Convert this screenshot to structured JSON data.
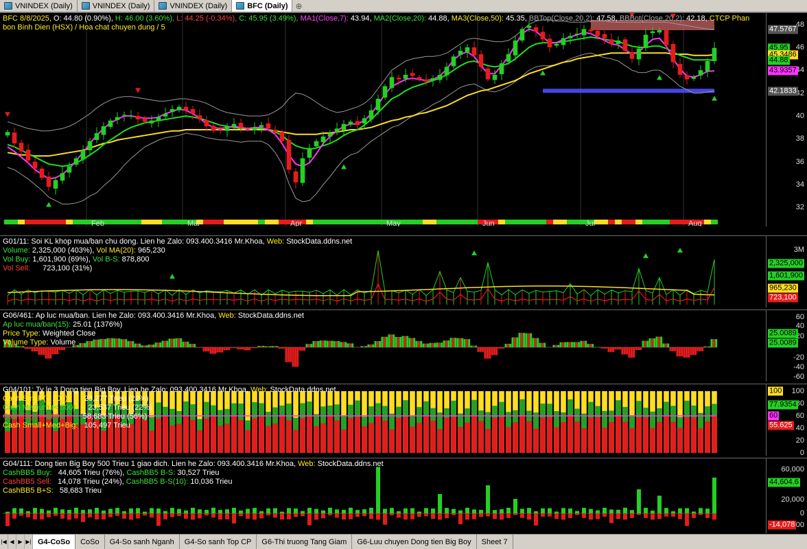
{
  "tabs": [
    {
      "label": "VNINDEX (Daily)",
      "active": false
    },
    {
      "label": "VNINDEX (Daily)",
      "active": false
    },
    {
      "label": "VNINDEX (Daily)",
      "active": false
    },
    {
      "label": "BFC (Daily)",
      "active": true
    }
  ],
  "colors": {
    "up": "#23d123",
    "down": "#e61c1c",
    "ma7": "#ff33ff",
    "ma20": "#22dd22",
    "ma50": "#ffdd22",
    "bb": "#9a9a9a",
    "resistance": "#c86464",
    "support": "#4d4dff"
  },
  "price_panel": {
    "legend_line1_parts": [
      {
        "t": "BFC 8/8/2025, ",
        "c": "c-yellow"
      },
      {
        "t": "O: 44.80 (0.90%), ",
        "c": "c-white"
      },
      {
        "t": "H: 46.00 (3.60%), ",
        "c": "c-green"
      },
      {
        "t": "L: 44.25 (-0.34%), ",
        "c": "c-red"
      },
      {
        "t": "C: 45.95 (3.49%), ",
        "c": "c-green"
      },
      {
        "t": "MA1(Close,7): ",
        "c": "c-magenta"
      },
      {
        "t": "43.94, ",
        "c": "c-white"
      },
      {
        "t": "MA2(Close,20): ",
        "c": "c-green"
      },
      {
        "t": "44.88, ",
        "c": "c-white"
      },
      {
        "t": "MA3(Close,50): ",
        "c": "c-yellow"
      },
      {
        "t": "45.35, ",
        "c": "c-white"
      },
      {
        "t": "BBTop(Close,20,2): ",
        "c": "c-gray"
      },
      {
        "t": "47.58, ",
        "c": "c-white"
      },
      {
        "t": "BBBot(Close,20,2): ",
        "c": "c-gray"
      },
      {
        "t": "42.18, ",
        "c": "c-white"
      },
      {
        "t": "CTCP Phan",
        "c": "c-yellow"
      }
    ],
    "legend_line2": "bon Binh Dien (HSX) / Hoa chat chuyen dung / 5",
    "y_ticks": [
      "48",
      "46",
      "44",
      "42",
      "40",
      "38",
      "36",
      "34",
      "32"
    ],
    "badges": [
      {
        "label": "47.5767",
        "bg": "#555",
        "fg": "#fff",
        "value": 47.5767
      },
      {
        "label": "45.95",
        "bg": "#23d123",
        "fg": "#000",
        "value": 45.95
      },
      {
        "label": "45.3486",
        "bg": "#ffdd22",
        "fg": "#000",
        "value": 45.3486
      },
      {
        "label": "44.88",
        "bg": "#23d123",
        "fg": "#000",
        "value": 44.88
      },
      {
        "label": "43.9357",
        "bg": "#ff33ff",
        "fg": "#000",
        "value": 43.9357
      },
      {
        "label": "42.1833",
        "bg": "#555",
        "fg": "#fff",
        "value": 42.1833
      }
    ],
    "x_labels": [
      {
        "label": "Feb",
        "i": 12
      },
      {
        "label": "Mar",
        "i": 26
      },
      {
        "label": "Apr",
        "i": 41
      },
      {
        "label": "May",
        "i": 55
      },
      {
        "label": "Jun",
        "i": 69
      },
      {
        "label": "Jul",
        "i": 84
      },
      {
        "label": "Aug",
        "i": 99
      }
    ]
  },
  "volume_panel": {
    "legend": [
      [
        {
          "t": "G01/11: Soi KL khop mua/ban chu dong. Lien he Zalo: ",
          "c": "c-white"
        },
        {
          "t": "093.400.3416 Mr.Khoa, ",
          "c": "c-white"
        },
        {
          "t": "Web: ",
          "c": "c-yellow"
        },
        {
          "t": "StockData.ddns.net",
          "c": "c-white"
        }
      ],
      [
        {
          "t": "Volume: ",
          "c": "c-green"
        },
        {
          "t": "2,325,000 (403%), ",
          "c": "c-white"
        },
        {
          "t": "Vol MA(20): ",
          "c": "c-yellow"
        },
        {
          "t": "965,230",
          "c": "c-white"
        }
      ],
      [
        {
          "t": "Vol Buy: ",
          "c": "c-green"
        },
        {
          "t": "1,601,900 (69%), ",
          "c": "c-white"
        },
        {
          "t": "Vol B-S: ",
          "c": "c-green"
        },
        {
          "t": "878,800",
          "c": "c-white"
        }
      ],
      [
        {
          "t": "Vol Sell: ",
          "c": "c-red"
        },
        {
          "t": "     723,100 (31%)",
          "c": "c-white"
        }
      ]
    ],
    "y_ticks": [
      "3M"
    ],
    "badges": [
      {
        "label": "2,325,000",
        "bg": "#23d123",
        "fg": "#000"
      },
      {
        "label": "1,601,900",
        "bg": "#23d123",
        "fg": "#000"
      },
      {
        "label": "965,230",
        "bg": "#ffdd22",
        "fg": "#000"
      },
      {
        "label": "723,100",
        "bg": "#e61c1c",
        "fg": "#fff"
      }
    ]
  },
  "pressure_panel": {
    "legend": [
      [
        {
          "t": "G06/461: Ap luc mua/ban. Lien he Zalo: 093.400.3416 Mr.Khoa, ",
          "c": "c-white"
        },
        {
          "t": "Web: ",
          "c": "c-yellow"
        },
        {
          "t": "StockData.ddns.net",
          "c": "c-white"
        }
      ],
      [
        {
          "t": "Ap luc mua/ban(15): ",
          "c": "c-green"
        },
        {
          "t": "25.01 (1376%)",
          "c": "c-white"
        }
      ],
      [
        {
          "t": "Price Type: ",
          "c": "c-yellow"
        },
        {
          "t": "Weighted Close",
          "c": "c-white"
        }
      ],
      [
        {
          "t": "Volume Type: ",
          "c": "c-yellow"
        },
        {
          "t": "Volume",
          "c": "c-white"
        }
      ]
    ],
    "y_ticks": [
      "60",
      "40",
      "20",
      "-20",
      "-40",
      "-60"
    ],
    "badges": [
      {
        "label": "25.0089",
        "bg": "#23d123",
        "fg": "#000"
      },
      {
        "label": "25.0089",
        "bg": "#23d123",
        "fg": "#000"
      }
    ]
  },
  "ratio_panel": {
    "legend": [
      [
        {
          "t": "G04/101: Ty le 3 Dong tien Big Boy. Lien he Zalo: 093.400.3416 Mr.Khoa, ",
          "c": "c-white"
        },
        {
          "t": "Web: ",
          "c": "c-yellow"
        },
        {
          "t": "StockData.ddns.net",
          "c": "c-white"
        }
      ],
      [
        {
          "t": "Cash Small (< 200):",
          "c": "c-yellow"
        },
        {
          "t": "       23,277 Trieu (22%)",
          "c": "c-white"
        }
      ],
      [
        {
          "t": "Cash Medium (< 500):",
          "c": "c-green"
        },
        {
          "t": "     23,537 Trieu (22%)",
          "c": "c-white"
        }
      ],
      [
        {
          "t": "Cash Big (>=500):",
          "c": "c-red"
        },
        {
          "t": "         58,683 Trieu (56%)",
          "c": "c-white"
        }
      ],
      [
        {
          "t": "Cash Small+Med+Big:",
          "c": "c-yellow"
        },
        {
          "t": "   105,497 Trieu",
          "c": "c-white"
        }
      ]
    ],
    "y_ticks": [
      "100",
      "80",
      "60",
      "40",
      "20",
      "0"
    ],
    "badges": [
      {
        "label": "100",
        "bg": "#ffdd22",
        "fg": "#000"
      },
      {
        "label": "77.9354",
        "bg": "#23d123",
        "fg": "#000"
      },
      {
        "label": "60",
        "bg": "#ff33ff",
        "fg": "#000"
      },
      {
        "label": "55.625",
        "bg": "#e61c1c",
        "fg": "#fff"
      }
    ]
  },
  "bigboy_panel": {
    "legend": [
      [
        {
          "t": "G04/111: Dong tien Big Boy 500 Trieu 1 giao dich. Lien he Zalo: 093.400.3416 Mr.Khoa, ",
          "c": "c-white"
        },
        {
          "t": "Web: ",
          "c": "c-yellow"
        },
        {
          "t": "StockData.ddns.net",
          "c": "c-white"
        }
      ],
      [
        {
          "t": "CashBB5 Buy: ",
          "c": "c-green"
        },
        {
          "t": "  44,605 Trieu (76%), ",
          "c": "c-white"
        },
        {
          "t": "CashBB5 B-S: ",
          "c": "c-green"
        },
        {
          "t": "30,527 Trieu",
          "c": "c-white"
        }
      ],
      [
        {
          "t": "CashBB5 Sell: ",
          "c": "c-red"
        },
        {
          "t": "  14,078 Trieu (24%), ",
          "c": "c-white"
        },
        {
          "t": "CashBB5 B-S(10): ",
          "c": "c-green"
        },
        {
          "t": "10,036 Trieu",
          "c": "c-white"
        }
      ],
      [
        {
          "t": "CashBB5 B+S: ",
          "c": "c-yellow"
        },
        {
          "t": "  58,683 Trieu",
          "c": "c-white"
        }
      ]
    ],
    "y_ticks": [
      "60,000",
      "20,000",
      "0",
      "-20,000"
    ],
    "badges": [
      {
        "label": "44,604.6",
        "bg": "#23d123",
        "fg": "#000"
      },
      {
        "label": "-14,078",
        "bg": "#e61c1c",
        "fg": "#fff"
      }
    ]
  },
  "sheet_tabs": [
    {
      "label": "G4-CoSo",
      "active": true
    },
    {
      "label": "CoSo",
      "active": false
    },
    {
      "label": "G4-So sanh Nganh",
      "active": false
    },
    {
      "label": "G4-So sanh Top CP",
      "active": false
    },
    {
      "label": "G6-Thi truong Tang Giam",
      "active": false
    },
    {
      "label": "G6-Luu chuyen Dong tien Big Boy",
      "active": false
    },
    {
      "label": "Sheet 7",
      "active": false
    }
  ],
  "chart_data": {
    "type": "candlestick",
    "ylim": [
      31,
      49
    ],
    "close": [
      38.6,
      37.6,
      36.9,
      36.1,
      35.4,
      34.6,
      33.8,
      34.4,
      35.0,
      35.6,
      36.3,
      37.0,
      37.8,
      38.5,
      39.1,
      39.6,
      39.9,
      40.1,
      40.0,
      39.7,
      39.5,
      39.6,
      39.9,
      40.2,
      40.6,
      40.8,
      40.5,
      40.2,
      39.7,
      39.1,
      38.7,
      38.8,
      39.1,
      39.3,
      39.0,
      38.8,
      39.0,
      39.2,
      38.9,
      38.6,
      37.8,
      35.3,
      34.2,
      36.3,
      37.2,
      37.8,
      38.2,
      38.5,
      38.9,
      39.3,
      39.5,
      39.2,
      39.8,
      40.5,
      41.5,
      42.6,
      43.4,
      43.2,
      43.6,
      43.5,
      43.2,
      43.0,
      43.3,
      43.6,
      44.3,
      45.2,
      45.7,
      46.0,
      45.3,
      44.3,
      43.2,
      43.6,
      44.6,
      45.4,
      46.6,
      47.6,
      47.9,
      47.4,
      46.7,
      46.0,
      46.3,
      46.8,
      47.0,
      47.2,
      47.6,
      47.4,
      47.0,
      46.8,
      46.3,
      46.6,
      45.7,
      45.0,
      45.9,
      47.1,
      47.4,
      47.5,
      46.2,
      44.7,
      43.6,
      43.2,
      43.4,
      44.0,
      44.8,
      45.95
    ],
    "ma7": [
      37.3,
      36.9,
      36.4,
      35.9,
      35.3,
      34.9,
      34.5,
      34.6,
      34.9,
      35.4,
      36.1,
      36.8,
      37.6,
      38.3,
      38.9,
      39.4,
      39.7,
      40.0,
      40.0,
      39.9,
      39.8,
      39.8,
      39.9,
      40.2,
      40.4,
      40.6,
      40.5,
      40.2,
      39.8,
      39.3,
      39.0,
      38.9,
      39.0,
      39.1,
      39.0,
      38.9,
      39.0,
      39.0,
      38.8,
      38.4,
      37.6,
      36.6,
      35.8,
      35.6,
      35.9,
      36.7,
      37.6,
      38.2,
      38.7,
      39.1,
      39.3,
      39.3,
      39.6,
      40.2,
      41.0,
      41.9,
      42.6,
      42.9,
      43.2,
      43.3,
      43.2,
      43.1,
      43.2,
      43.5,
      44.1,
      44.9,
      45.4,
      45.6,
      45.2,
      44.4,
      43.7,
      43.7,
      44.4,
      45.2,
      46.2,
      47.2,
      47.6,
      47.4,
      46.9,
      46.4,
      46.4,
      46.7,
      46.9,
      47.1,
      47.3,
      47.2,
      46.9,
      46.6,
      46.3,
      46.2,
      45.8,
      45.4,
      45.6,
      46.2,
      46.7,
      46.8,
      46.1,
      45.0,
      44.1,
      43.5,
      43.4,
      43.6,
      43.9,
      43.94
    ],
    "ma20": [
      37.5,
      37.3,
      37.0,
      36.7,
      36.4,
      36.1,
      35.8,
      35.7,
      35.6,
      35.7,
      35.9,
      36.2,
      36.6,
      37.0,
      37.5,
      37.9,
      38.3,
      38.7,
      39.0,
      39.2,
      39.4,
      39.5,
      39.6,
      39.7,
      39.8,
      39.9,
      40.0,
      39.9,
      39.8,
      39.6,
      39.4,
      39.2,
      39.1,
      39.0,
      38.9,
      38.9,
      38.9,
      38.9,
      38.8,
      38.6,
      38.3,
      37.8,
      37.4,
      37.2,
      37.1,
      37.2,
      37.4,
      37.6,
      37.9,
      38.3,
      38.6,
      38.8,
      39.2,
      39.7,
      40.3,
      40.9,
      41.5,
      41.8,
      42.2,
      42.5,
      42.7,
      42.9,
      43.1,
      43.3,
      43.6,
      44.0,
      44.4,
      44.7,
      44.8,
      44.6,
      44.4,
      44.3,
      44.4,
      44.6,
      45.0,
      45.5,
      46.0,
      46.3,
      46.4,
      46.4,
      46.4,
      46.5,
      46.6,
      46.7,
      46.8,
      46.9,
      46.8,
      46.7,
      46.6,
      46.5,
      46.3,
      46.1,
      46.0,
      46.0,
      46.1,
      46.1,
      45.9,
      45.6,
      45.3,
      45.1,
      44.9,
      44.9,
      44.9,
      44.88
    ],
    "ma50": [
      36.8,
      36.7,
      36.6,
      36.6,
      36.5,
      36.5,
      36.5,
      36.6,
      36.7,
      36.8,
      36.9,
      37.0,
      37.2,
      37.4,
      37.6,
      37.7,
      37.9,
      38.0,
      38.1,
      38.2,
      38.3,
      38.4,
      38.5,
      38.6,
      38.7,
      38.7,
      38.8,
      38.8,
      38.8,
      38.8,
      38.8,
      38.8,
      38.8,
      38.8,
      38.8,
      38.8,
      38.8,
      38.8,
      38.8,
      38.7,
      38.6,
      38.5,
      38.4,
      38.4,
      38.4,
      38.4,
      38.5,
      38.5,
      38.6,
      38.7,
      38.8,
      38.8,
      38.9,
      39.0,
      39.2,
      39.4,
      39.6,
      39.7,
      39.9,
      40.0,
      40.2,
      40.3,
      40.5,
      40.7,
      40.9,
      41.2,
      41.5,
      41.8,
      42.0,
      42.2,
      42.3,
      42.5,
      42.7,
      42.9,
      43.1,
      43.4,
      43.7,
      43.9,
      44.1,
      44.3,
      44.5,
      44.7,
      44.8,
      45.0,
      45.1,
      45.2,
      45.3,
      45.4,
      45.5,
      45.5,
      45.5,
      45.5,
      45.5,
      45.5,
      45.5,
      45.5,
      45.5,
      45.4,
      45.4,
      45.4,
      45.3,
      45.3,
      45.3,
      45.35
    ],
    "bb_top": [
      39.5,
      39.3,
      39.1,
      38.9,
      38.8,
      38.7,
      38.7,
      38.8,
      38.9,
      39.1,
      39.4,
      39.8,
      40.2,
      40.7,
      41.1,
      41.4,
      41.6,
      41.7,
      41.7,
      41.6,
      41.5,
      41.4,
      41.3,
      41.3,
      41.4,
      41.5,
      41.5,
      41.4,
      41.3,
      41.1,
      40.8,
      40.5,
      40.3,
      40.2,
      40.1,
      40.0,
      40.0,
      40.0,
      40.1,
      40.4,
      40.8,
      41.5,
      42.0,
      41.9,
      41.6,
      41.2,
      40.8,
      40.5,
      40.3,
      40.4,
      40.6,
      40.8,
      41.1,
      41.6,
      42.4,
      43.2,
      44.0,
      44.4,
      44.8,
      45.0,
      45.1,
      45.2,
      45.2,
      45.3,
      45.5,
      45.9,
      46.3,
      46.7,
      46.8,
      46.7,
      46.6,
      46.5,
      46.5,
      46.6,
      47.0,
      47.5,
      48.0,
      48.3,
      48.4,
      48.4,
      48.3,
      48.3,
      48.2,
      48.2,
      48.2,
      48.3,
      48.3,
      48.3,
      48.2,
      48.2,
      48.2,
      48.2,
      48.2,
      48.2,
      48.2,
      48.2,
      48.2,
      48.1,
      48.0,
      47.9,
      47.8,
      47.7,
      47.6,
      47.58
    ],
    "bb_bot": [
      35.5,
      35.3,
      34.9,
      34.5,
      34.0,
      33.5,
      32.9,
      32.6,
      32.3,
      32.3,
      32.4,
      32.6,
      33.0,
      33.3,
      33.9,
      34.4,
      35.0,
      35.7,
      36.3,
      36.8,
      37.3,
      37.6,
      37.9,
      38.1,
      38.2,
      38.3,
      38.5,
      38.4,
      38.3,
      38.1,
      38.0,
      37.9,
      37.9,
      37.8,
      37.7,
      37.8,
      37.8,
      37.8,
      37.5,
      36.8,
      35.8,
      34.1,
      32.8,
      32.5,
      32.6,
      33.2,
      34.0,
      34.7,
      35.5,
      36.2,
      36.6,
      36.8,
      37.3,
      37.8,
      38.2,
      38.6,
      39.0,
      39.2,
      39.6,
      40.0,
      40.3,
      40.6,
      41.0,
      41.3,
      41.7,
      42.1,
      42.5,
      42.7,
      42.8,
      42.5,
      42.2,
      42.1,
      42.3,
      42.6,
      43.0,
      43.5,
      44.0,
      44.3,
      44.4,
      44.4,
      44.5,
      44.7,
      45.0,
      45.2,
      45.4,
      45.5,
      45.3,
      45.1,
      45.0,
      44.8,
      44.4,
      44.0,
      43.8,
      43.8,
      44.0,
      44.0,
      43.6,
      43.1,
      42.6,
      42.3,
      42.0,
      42.0,
      42.1,
      42.18
    ],
    "resistance_zone": [
      47.5,
      48.4
    ],
    "support_level": 42.2
  }
}
